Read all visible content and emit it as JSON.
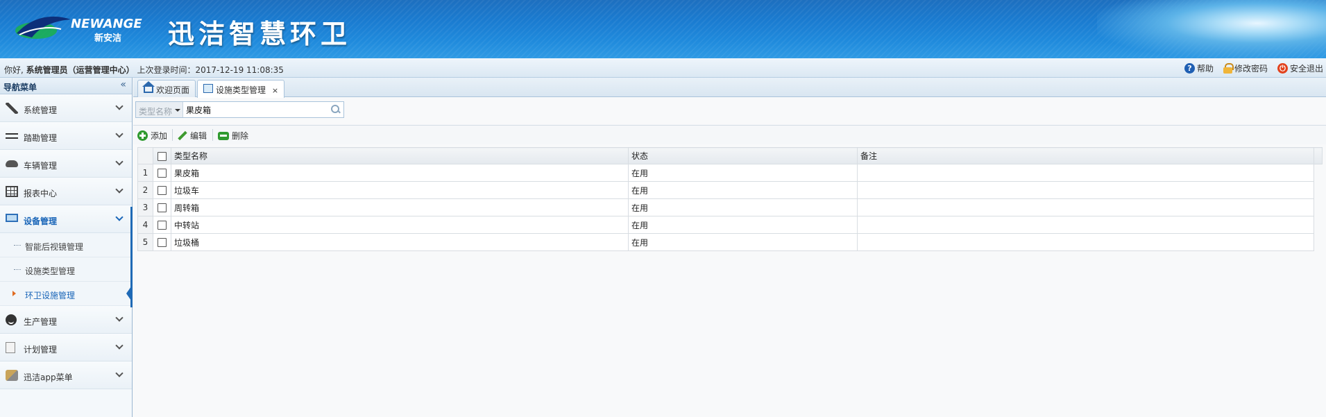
{
  "header": {
    "logo_text_en": "NEWANGE",
    "logo_text_cn": "新安洁",
    "system_title": "迅洁智慧环卫"
  },
  "infobar": {
    "greeting": "你好, ",
    "user": "系统管理员（运营管理中心）",
    "last_login_label": " 上次登录时间：",
    "last_login_time": "2017-12-19 11:08:35",
    "help": "帮助",
    "change_password": "修改密码",
    "logout": "安全退出"
  },
  "sidebar": {
    "title": "导航菜单",
    "collapse_glyph": "«",
    "items": [
      {
        "label": "系统管理",
        "icon": "wrench-icon"
      },
      {
        "label": "踏勘管理",
        "icon": "exchange-icon"
      },
      {
        "label": "车辆管理",
        "icon": "cloud-icon"
      },
      {
        "label": "报表中心",
        "icon": "table-icon"
      },
      {
        "label": "设备管理",
        "icon": "monitor-icon"
      },
      {
        "label": "生产管理",
        "icon": "face-icon"
      },
      {
        "label": "计划管理",
        "icon": "document-icon"
      },
      {
        "label": "迅洁app菜单",
        "icon": "app-icon"
      }
    ],
    "device_submenu": [
      {
        "label": "智能后视镜管理"
      },
      {
        "label": "设施类型管理"
      },
      {
        "label": "环卫设施管理"
      }
    ]
  },
  "tabs": [
    {
      "label": "欢迎页面",
      "icon": "home-icon"
    },
    {
      "label": "设施类型管理",
      "icon": "form-icon",
      "close": "×"
    }
  ],
  "search": {
    "type_label": "类型名称",
    "value": "果皮箱"
  },
  "toolbar": {
    "add": "添加",
    "edit": "编辑",
    "delete": "删除"
  },
  "grid": {
    "columns": [
      "类型名称",
      "状态",
      "备注"
    ],
    "rows": [
      {
        "no": "1",
        "name": "果皮箱",
        "status": "在用",
        "remark": ""
      },
      {
        "no": "2",
        "name": "垃圾车",
        "status": "在用",
        "remark": ""
      },
      {
        "no": "3",
        "name": "周转箱",
        "status": "在用",
        "remark": ""
      },
      {
        "no": "4",
        "name": "中转站",
        "status": "在用",
        "remark": ""
      },
      {
        "no": "5",
        "name": "垃圾桶",
        "status": "在用",
        "remark": ""
      }
    ]
  }
}
